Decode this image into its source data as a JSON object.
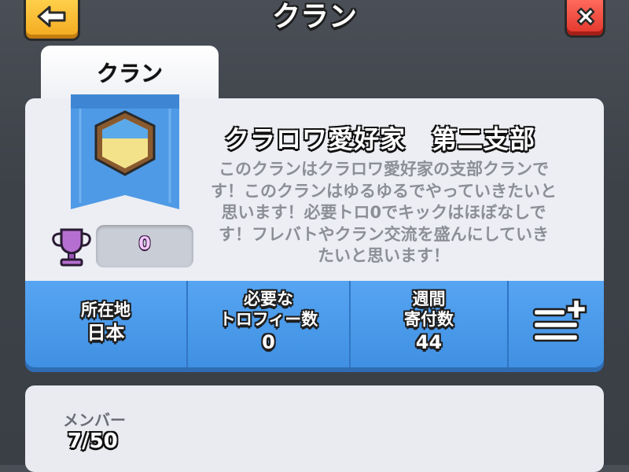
{
  "header": {
    "title": "クラン",
    "back_icon": "arrow-left-icon",
    "close_icon": "close-x-icon"
  },
  "tab": {
    "label": "クラン"
  },
  "clan": {
    "name": "クラロワ愛好家　第二支部",
    "description": "このクランはクラロワ愛好家の支部クランです！このクランはゆるゆるでやっていきたいと思います！必要トロ0でキックはほぼなしです！フレバトやクラン交流を盛んにしていきたいと思います！",
    "trophies": "0",
    "badge_icon": "clan-shield-icon",
    "trophy_icon": "trophy-icon"
  },
  "stats": {
    "location": {
      "label": "所在地",
      "value": "日本"
    },
    "required_trophies": {
      "label_line1": "必要な",
      "label_line2": "トロフィー数",
      "value": "0"
    },
    "weekly_donations": {
      "label_line1": "週間",
      "label_line2": "寄付数",
      "value": "44"
    },
    "menu_icon": "list-add-icon"
  },
  "members": {
    "label": "メンバー",
    "count": "7/50"
  },
  "colors": {
    "accent_blue": "#4a9aea",
    "back_button": "#f3a91e",
    "close_button": "#e3342a",
    "trophy_purple": "#b56fd1"
  }
}
